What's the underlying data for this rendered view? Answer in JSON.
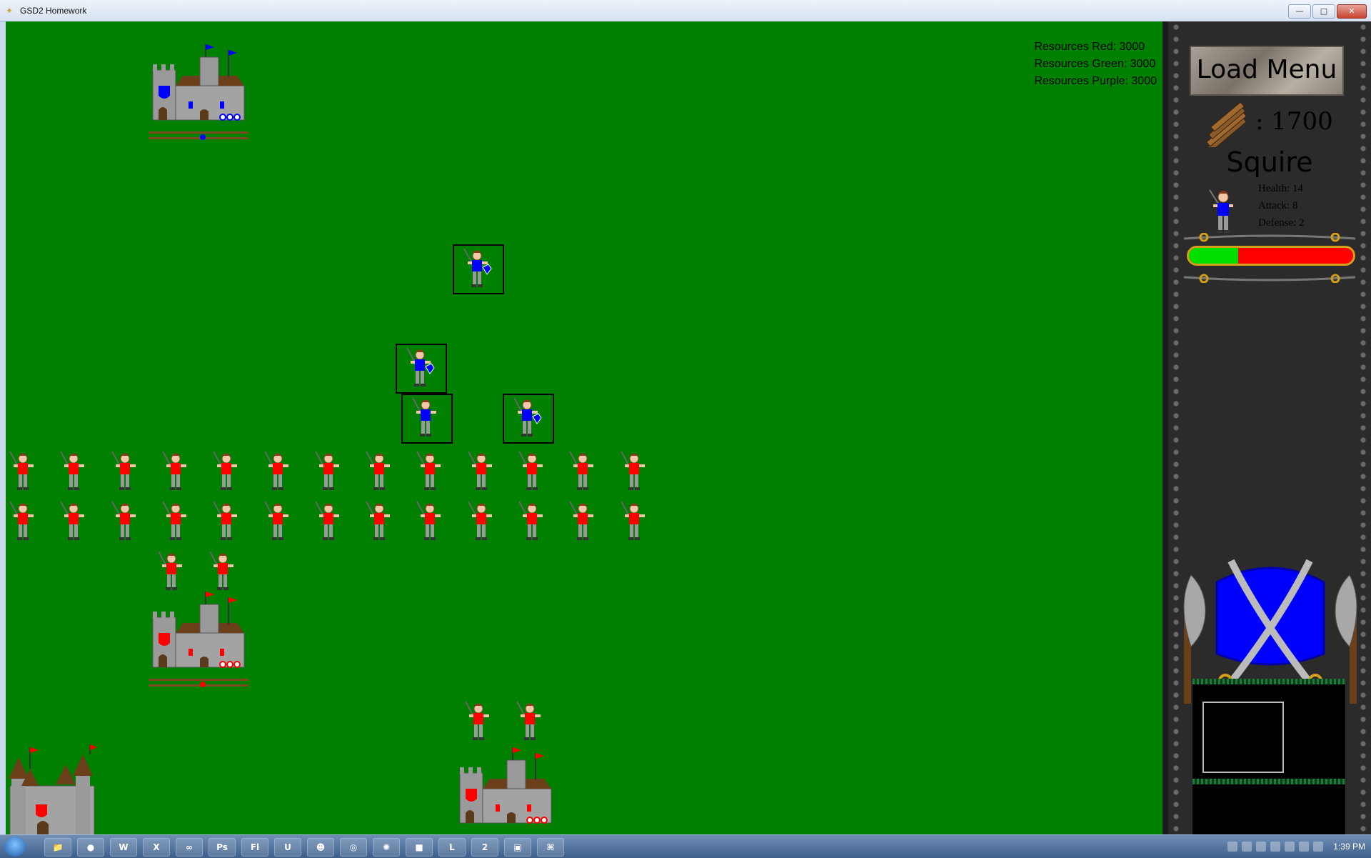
{
  "window": {
    "title": "GSD2 Homework",
    "min": "—",
    "max": "□",
    "close": "✕"
  },
  "resources": {
    "red": "Resources Red: 3000",
    "green": "Resources Green: 3000",
    "purple": "Resources Purple: 3000"
  },
  "panel": {
    "load_menu": "Load Menu",
    "wood": ": 1700",
    "unit_name": "Squire",
    "stats": {
      "health": "Health: 14",
      "attack": "Attack: 8",
      "defense": "Defense: 2"
    },
    "health_fraction": 0.3
  },
  "colors": {
    "grass": "#008000",
    "red_team": "#ff0000",
    "blue_team": "#0000ff",
    "panel": "#2b2b2b"
  },
  "taskbar": {
    "apps": [
      "explorer",
      "chrome",
      "word",
      "excel",
      "visual-studio",
      "photoshop",
      "flash",
      "unity",
      "gimp",
      "inkscape",
      "blender",
      "minecraft",
      "league",
      "ts",
      "cmd",
      "controller"
    ],
    "clock": "1:39 PM"
  }
}
